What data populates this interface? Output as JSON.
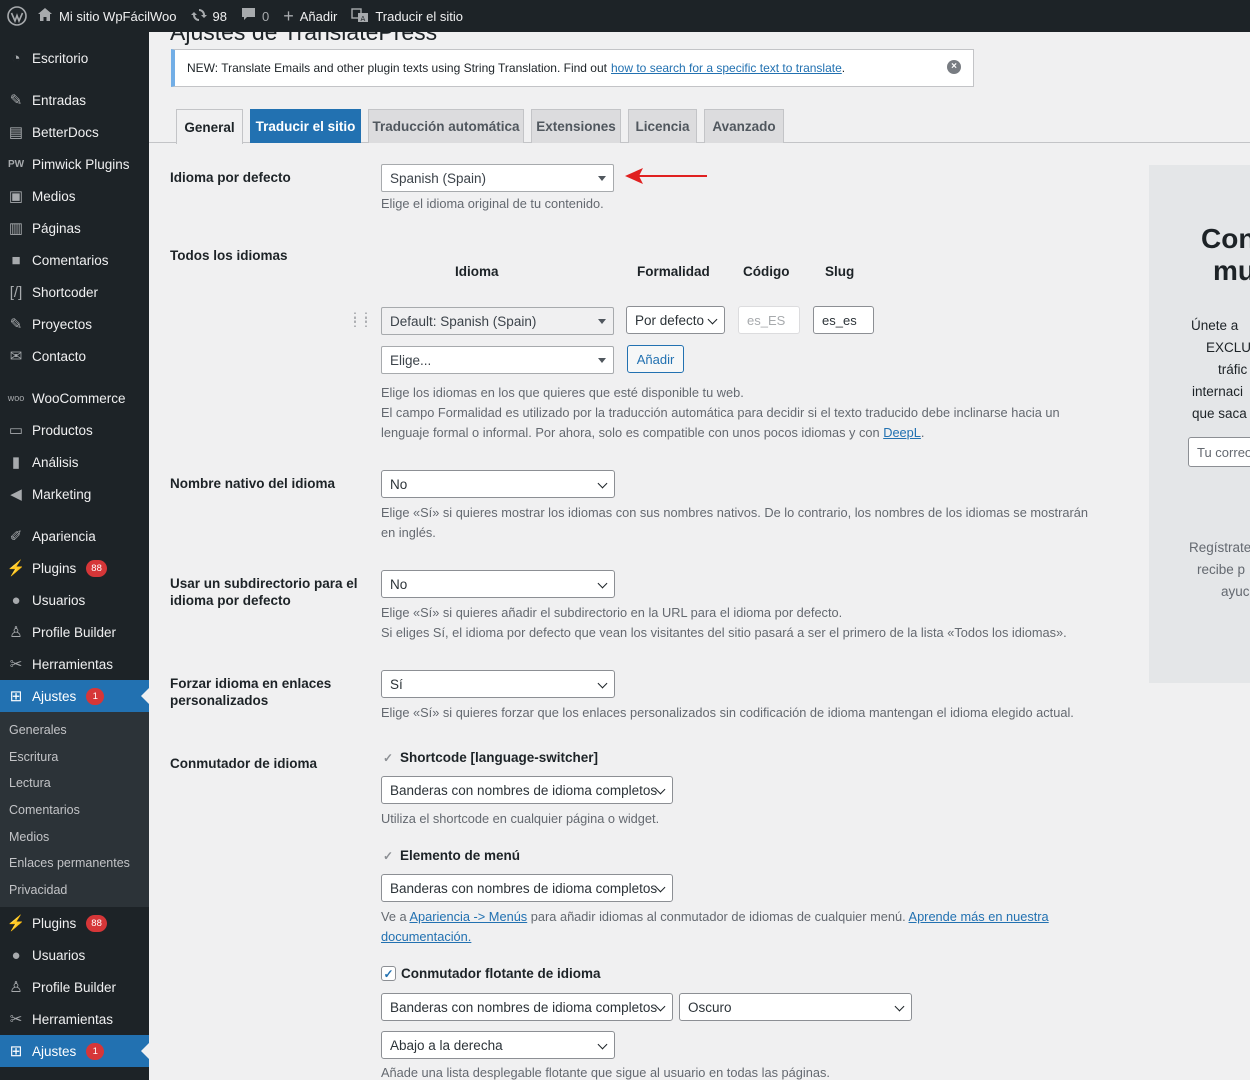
{
  "adminbar": {
    "site_name": "Mi sitio WpFácilWoo",
    "updates_count": "98",
    "comments_count": "0",
    "new_label": "Añadir",
    "translate_label": "Traducir el sitio"
  },
  "sidebar": {
    "items": [
      {
        "label": "Escritorio",
        "icon": "dashboard-icon"
      },
      {
        "label": "Entradas",
        "icon": "pin-icon"
      },
      {
        "label": "BetterDocs",
        "icon": "docs-icon"
      },
      {
        "label": "Pimwick Plugins",
        "icon": "pw-icon"
      },
      {
        "label": "Medios",
        "icon": "media-icon"
      },
      {
        "label": "Páginas",
        "icon": "pages-icon"
      },
      {
        "label": "Comentarios",
        "icon": "comment-icon"
      },
      {
        "label": "Shortcoder",
        "icon": "shortcode-icon"
      },
      {
        "label": "Proyectos",
        "icon": "pin-icon"
      },
      {
        "label": "Contacto",
        "icon": "mail-icon"
      },
      {
        "label": "WooCommerce",
        "icon": "woo-icon"
      },
      {
        "label": "Productos",
        "icon": "archive-icon"
      },
      {
        "label": "Análisis",
        "icon": "chart-icon"
      },
      {
        "label": "Marketing",
        "icon": "megaphone-icon"
      },
      {
        "label": "Apariencia",
        "icon": "brush-icon"
      },
      {
        "label": "Plugins",
        "icon": "plugin-icon",
        "badge": "88"
      },
      {
        "label": "Usuarios",
        "icon": "users-icon"
      },
      {
        "label": "Profile Builder",
        "icon": "user-icon"
      },
      {
        "label": "Herramientas",
        "icon": "wrench-icon"
      },
      {
        "label": "Ajustes",
        "icon": "settings-icon",
        "badge": "1"
      }
    ],
    "submenu": [
      "Generales",
      "Escritura",
      "Lectura",
      "Comentarios",
      "Medios",
      "Enlaces permanentes",
      "Privacidad"
    ],
    "repeat_items": [
      {
        "label": "Plugins",
        "icon": "plugin-icon",
        "badge": "88"
      },
      {
        "label": "Usuarios",
        "icon": "users-icon"
      },
      {
        "label": "Profile Builder",
        "icon": "user-icon"
      },
      {
        "label": "Herramientas",
        "icon": "wrench-icon"
      },
      {
        "label": "Ajustes",
        "icon": "settings-icon",
        "badge": "1"
      }
    ]
  },
  "page": {
    "title": "Ajustes de TranslatePress"
  },
  "notice": {
    "text": "NEW: Translate Emails and other plugin texts using String Translation. Find out",
    "link": "how to search for a specific text to translate",
    "end": "."
  },
  "tabs": [
    "General",
    "Traducir el sitio",
    "Traducción automática",
    "Extensiones",
    "Licencia",
    "Avanzado"
  ],
  "settings": {
    "default_language": {
      "label": "Idioma por defecto",
      "value": "Spanish (Spain)",
      "desc": "Elige el idioma original de tu contenido."
    },
    "all_languages": {
      "label": "Todos los idiomas",
      "col_language": "Idioma",
      "col_formality": "Formalidad",
      "col_code": "Código",
      "col_slug": "Slug",
      "row_language": "Default: Spanish (Spain)",
      "row_formality": "Por defecto",
      "row_code": "es_ES",
      "row_slug": "es_es",
      "choose_placeholder": "Elige...",
      "add_button": "Añadir",
      "desc1": "Elige los idiomas en los que quieres que esté disponible tu web.",
      "desc2": "El campo Formalidad es utilizado por la traducción automática para decidir si el texto traducido debe inclinarse hacia un",
      "desc3": "lenguaje formal o informal. Por ahora, solo es compatible con unos pocos idiomas y con",
      "desc3_link": "DeepL",
      "desc3_end": "."
    },
    "native_name": {
      "label": "Nombre nativo del idioma",
      "value": "No",
      "desc1": "Elige «Sí» si quieres mostrar los idiomas con sus nombres nativos. De lo contrario, los nombres de los idiomas se mostrarán",
      "desc2": "en inglés."
    },
    "subdirectory": {
      "label1": "Usar un subdirectorio para el",
      "label2": "idioma por defecto",
      "value": "No",
      "desc1": "Elige «Sí» si quieres añadir el subdirectorio en la URL para el idioma por defecto.",
      "desc2": "Si eliges Sí, el idioma por defecto que vean los visitantes del sitio pasará a ser el primero de la lista «Todos los idiomas»."
    },
    "force_language": {
      "label1": "Forzar idioma en enlaces",
      "label2": "personalizados",
      "value": "Sí",
      "desc": "Elige «Sí» si quieres forzar que los enlaces personalizados sin codificación de idioma mantengan el idioma elegido actual."
    },
    "switcher": {
      "label": "Conmutador de idioma",
      "shortcode_label": "Shortcode [language-switcher]",
      "shortcode_value": "Banderas con nombres de idioma completos",
      "shortcode_desc": "Utiliza el shortcode en cualquier página o widget.",
      "menu_label": "Elemento de menú",
      "menu_value": "Banderas con nombres de idioma completos",
      "menu_desc_pre": "Ve a",
      "menu_desc_link": "Apariencia -> Menús",
      "menu_desc_mid": "para añadir idiomas al conmutador de idiomas de cualquier menú.",
      "menu_desc_link2": "Aprende más en nuestra",
      "menu_desc_link3": "documentación.",
      "floating_label": "Conmutador flotante de idioma",
      "floating_value": "Banderas con nombres de idioma completos",
      "floating_theme": "Oscuro",
      "floating_position": "Abajo a la derecha",
      "floating_desc": "Añade una lista desplegable flotante que sigue al usuario en todas las páginas."
    }
  },
  "promo": {
    "title1": "Con",
    "title2": "mu",
    "line1": "Únete a",
    "line2": "EXCLU",
    "line3": "tráfic",
    "line4": "internaci",
    "line5": "que saca",
    "email_placeholder": "Tu correo",
    "small1": "Regístrate",
    "small2": "recibe p",
    "small3": "ayuc"
  },
  "colors": {
    "accent": "#2271b1",
    "sidebar_bg": "#1d2327",
    "badge": "#d63638",
    "arrow": "#e02020"
  }
}
